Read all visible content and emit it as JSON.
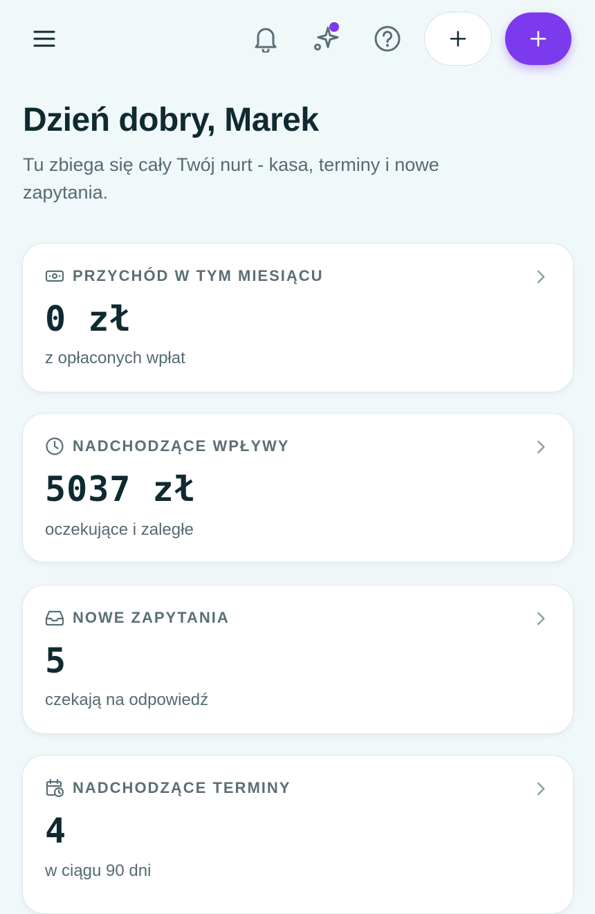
{
  "header": {
    "menu_icon": "hamburger-menu-icon",
    "notifications_icon": "bell-icon",
    "assistant_icon": "sparkle-icon",
    "help_icon": "help-circle-icon",
    "quick_add_label": "+",
    "primary_add_label": "+",
    "accent_color": "#7c3aed"
  },
  "welcome": {
    "greeting": "Dzień dobry, Marek",
    "subtitle": "Tu zbiega się cały Twój nurt - kasa, terminy i nowe zapytania."
  },
  "cards": [
    {
      "icon": "banknote-icon",
      "title": "PRZYCHÓD W TYM MIESIĄCU",
      "value": "0 zł",
      "caption": "z opłaconych wpłat"
    },
    {
      "icon": "clock-icon",
      "title": "NADCHODZĄCE WPŁYWY",
      "value": "5037 zł",
      "caption": "oczekujące i zaległe"
    },
    {
      "icon": "inbox-icon",
      "title": "NOWE ZAPYTANIA",
      "value": "5",
      "caption": "czekają na odpowiedź"
    },
    {
      "icon": "calendar-clock-icon",
      "title": "NADCHODZĄCE TERMINY",
      "value": "4",
      "caption": "w ciągu 90 dni"
    }
  ]
}
